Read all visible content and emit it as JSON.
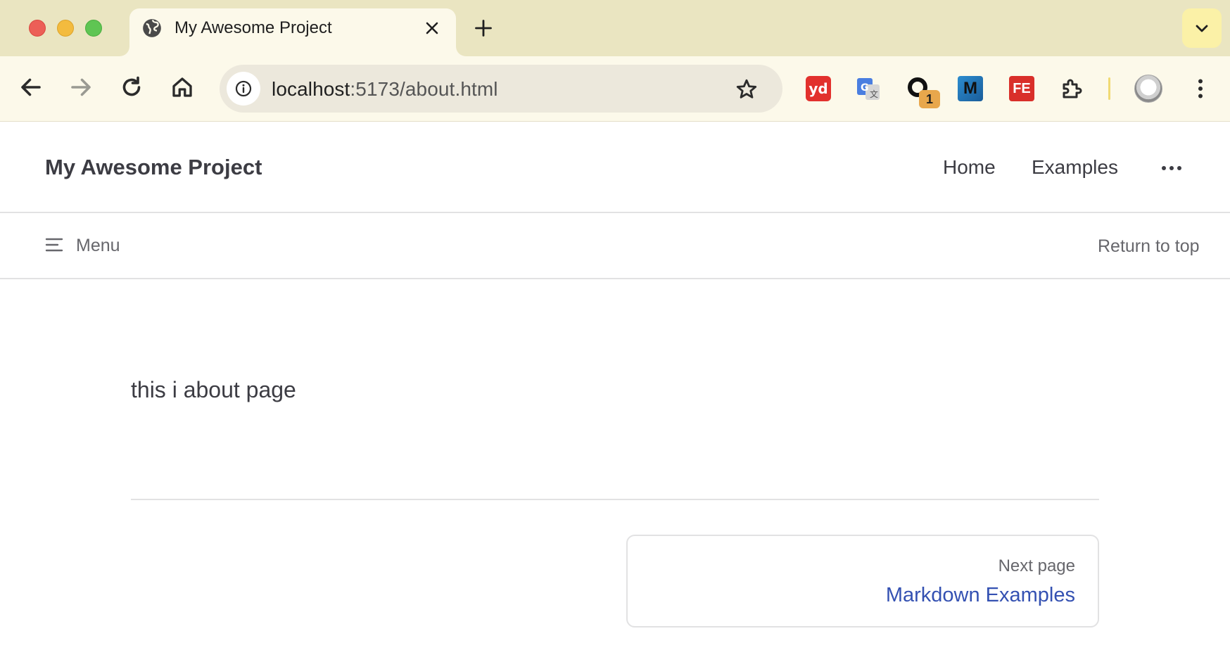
{
  "browser": {
    "tab": {
      "title": "My Awesome Project",
      "favicon": "globe-icon"
    },
    "address_bar": {
      "host": "localhost",
      "path": ":5173/about.html"
    },
    "extensions": {
      "youdao_label": "yd",
      "translate_icon": "google-translate-icon",
      "rewind_badge": "1",
      "m_label": "M",
      "fe_label": "FE"
    }
  },
  "site": {
    "title": "My Awesome Project",
    "nav": {
      "home": "Home",
      "examples": "Examples"
    }
  },
  "local_nav": {
    "menu_label": "Menu",
    "return_to_top": "Return to top"
  },
  "content": {
    "text": "this i about page"
  },
  "pager": {
    "next_label": "Next page",
    "next_title": "Markdown Examples"
  },
  "colors": {
    "accent_link": "#3451b2",
    "tabstrip": "#eae5c1",
    "toolbar": "#fcf9ea",
    "text": "#3c3c43",
    "muted": "#67676c"
  }
}
